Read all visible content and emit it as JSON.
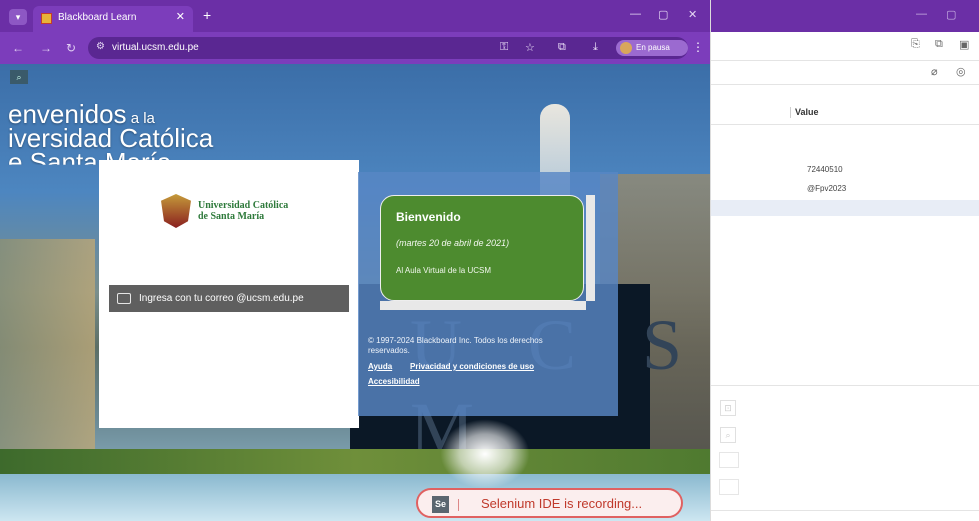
{
  "browser": {
    "tab_title": "Blackboard Learn",
    "url": "virtual.ucsm.edu.pe",
    "profile_status": "En pausa"
  },
  "page": {
    "welcome": {
      "line1_big": "envenidos",
      "line1_small": " a la",
      "line2": "iversidad Católica",
      "line3": "e Santa María"
    },
    "login": {
      "university_line1": "Universidad Católica",
      "university_line2": "de Santa María",
      "sso_button": "Ingresa con tu correo @ucsm.edu.pe"
    },
    "announcement": {
      "title": "Bienvenido",
      "date": "(martes 20 de abril de 2021)",
      "body": "Al Aula Virtual de la UCSM"
    },
    "footer": {
      "copyright": "© 1997-2024 Blackboard Inc. Todos los derechos reservados.",
      "help": "Ayuda",
      "privacy": "Privacidad y condiciones de uso",
      "accessibility": "Accesibilidad"
    },
    "background_letters": "U C S M"
  },
  "selenium": {
    "logo": "Se",
    "status": "Selenium IDE is recording..."
  },
  "side_panel": {
    "column_header": "Value",
    "values": [
      "72440510",
      "@Fpv2023"
    ]
  },
  "colors": {
    "browser_frame": "#6b2fa6",
    "green_box": "#4d8b2f",
    "recording_red": "#c0392b"
  }
}
